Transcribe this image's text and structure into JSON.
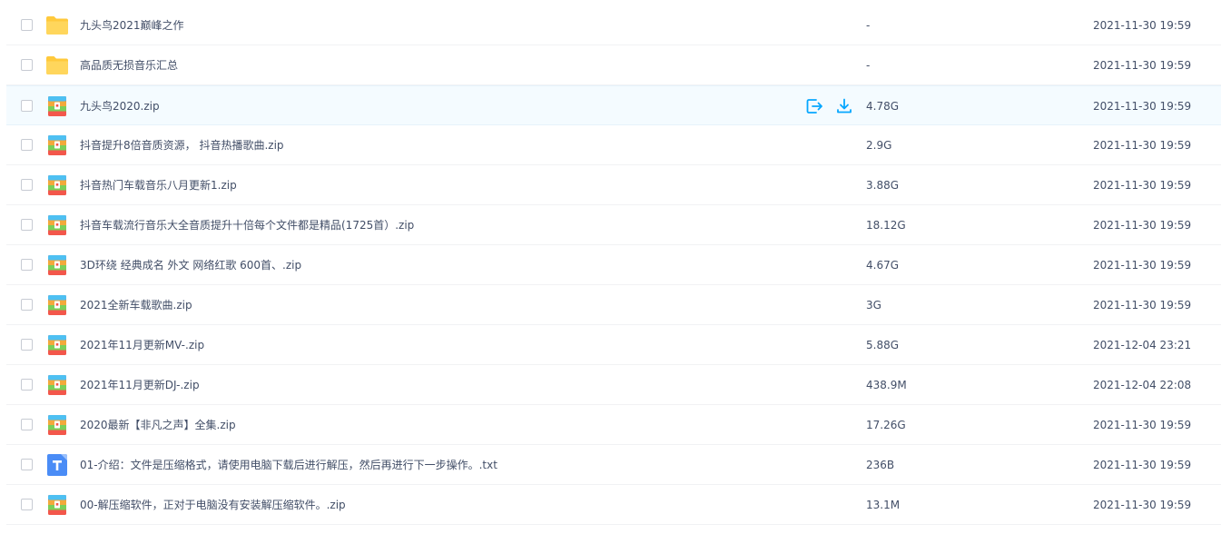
{
  "files": [
    {
      "name": "九头鸟2021巅峰之作",
      "type": "folder",
      "size": "-",
      "date": "2021-11-30 19:59"
    },
    {
      "name": "高品质无损音乐汇总",
      "type": "folder",
      "size": "-",
      "date": "2021-11-30 19:59"
    },
    {
      "name": "九头鸟2020.zip",
      "type": "zip",
      "size": "4.78G",
      "date": "2021-11-30 19:59"
    },
    {
      "name": "抖音提升8倍音质资源， 抖音热播歌曲.zip",
      "type": "zip",
      "size": "2.9G",
      "date": "2021-11-30 19:59"
    },
    {
      "name": "抖音热门车载音乐八月更新1.zip",
      "type": "zip",
      "size": "3.88G",
      "date": "2021-11-30 19:59"
    },
    {
      "name": "抖音车载流行音乐大全音质提升十倍每个文件都是精品(1725首）.zip",
      "type": "zip",
      "size": "18.12G",
      "date": "2021-11-30 19:59"
    },
    {
      "name": "3D环绕 经典成名 外文 网络红歌 600首、.zip",
      "type": "zip",
      "size": "4.67G",
      "date": "2021-11-30 19:59"
    },
    {
      "name": "2021全新车载歌曲.zip",
      "type": "zip",
      "size": "3G",
      "date": "2021-11-30 19:59"
    },
    {
      "name": "2021年11月更新MV-.zip",
      "type": "zip",
      "size": "5.88G",
      "date": "2021-12-04 23:21"
    },
    {
      "name": "2021年11月更新DJ-.zip",
      "type": "zip",
      "size": "438.9M",
      "date": "2021-12-04 22:08"
    },
    {
      "name": "2020最新【非凡之声】全集.zip",
      "type": "zip",
      "size": "17.26G",
      "date": "2021-11-30 19:59"
    },
    {
      "name": "01-介绍：文件是压缩格式，请使用电脑下载后进行解压，然后再进行下一步操作。.txt",
      "type": "txt",
      "size": "236B",
      "date": "2021-11-30 19:59"
    },
    {
      "name": "00-解压缩软件，正对于电脑没有安装解压缩软件。.zip",
      "type": "zip",
      "size": "13.1M",
      "date": "2021-11-30 19:59"
    }
  ],
  "hovered_row_index": 2,
  "colors": {
    "accent": "#06a7ff",
    "folder": "#ffd04e",
    "txt": "#4a8cf6",
    "text": "#424e67"
  },
  "icons": {
    "folder": "folder-icon",
    "zip": "zip-archive-icon",
    "txt": "text-file-icon",
    "share": "share-icon",
    "download": "download-icon"
  }
}
